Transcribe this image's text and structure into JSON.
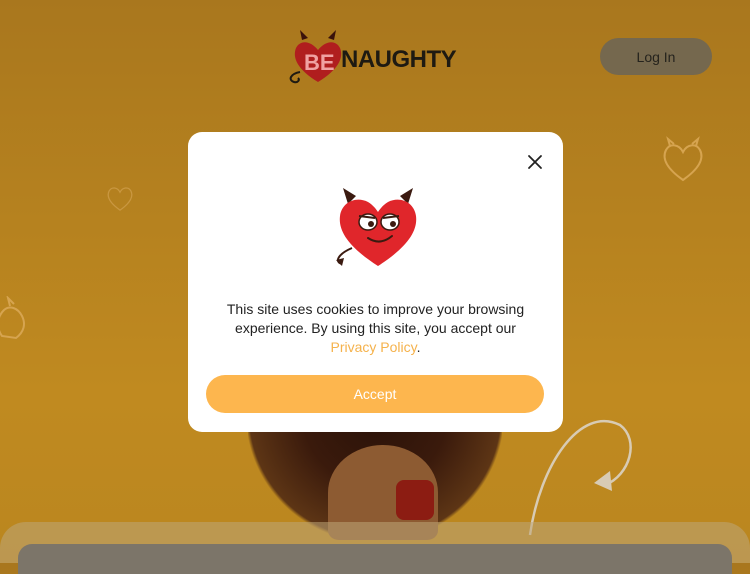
{
  "header": {
    "logo_text": "NAUGHTY",
    "logo_prefix": "BE",
    "login_label": "Log In"
  },
  "cookie_modal": {
    "message_part1": "This site uses cookies to improve your browsing experience. By using this site, you accept our",
    "policy_link": "Privacy Policy",
    "message_end": ".",
    "accept_label": "Accept"
  },
  "icons": {
    "close": "close-icon",
    "mascot": "devil-heart-icon",
    "logo_mark": "devil-heart-logo-icon"
  },
  "colors": {
    "background": "#b6821f",
    "accent": "#fdb64e",
    "link": "#f5b24c",
    "brand_red": "#e0262b",
    "login_bg": "#75684e"
  }
}
